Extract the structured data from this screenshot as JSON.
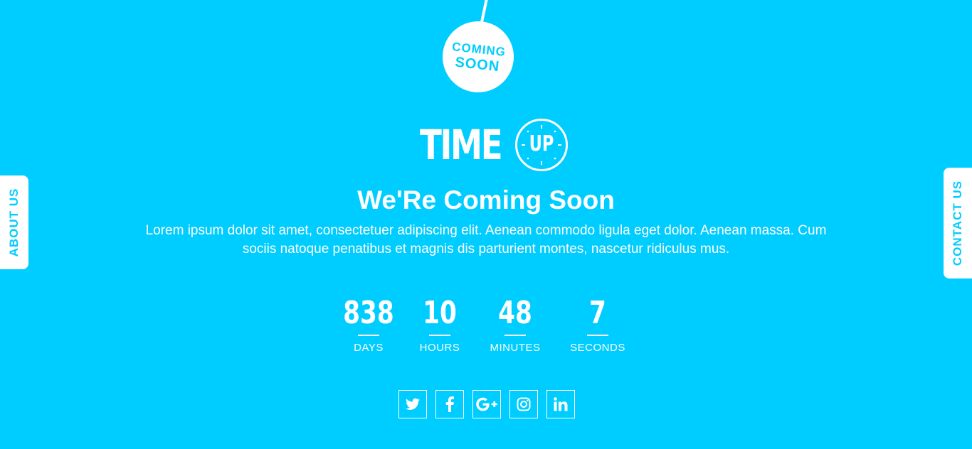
{
  "badge": {
    "line1": "COMING",
    "line2": "SOON"
  },
  "logo": {
    "word": "TIME",
    "clock_text": "UP"
  },
  "heading": "We'Re Coming Soon",
  "description": "Lorem ipsum dolor sit amet, consectetuer adipiscing elit. Aenean commodo ligula eget dolor. Aenean massa. Cum sociis natoque penatibus et magnis dis parturient montes, nascetur ridiculus mus.",
  "countdown": {
    "days": {
      "value": "838",
      "label": "DAYS"
    },
    "hours": {
      "value": "10",
      "label": "HOURS"
    },
    "minutes": {
      "value": "48",
      "label": "MINUTES"
    },
    "seconds": {
      "value": "7",
      "label": "SECONDS"
    }
  },
  "social": {
    "icons": [
      "twitter-icon",
      "facebook-icon",
      "google-plus-icon",
      "instagram-icon",
      "linkedin-icon"
    ]
  },
  "side_tabs": {
    "left": "ABOUT US",
    "right": "CONTACT US"
  },
  "colors": {
    "background": "#00cdff",
    "foreground": "#ffffff"
  }
}
